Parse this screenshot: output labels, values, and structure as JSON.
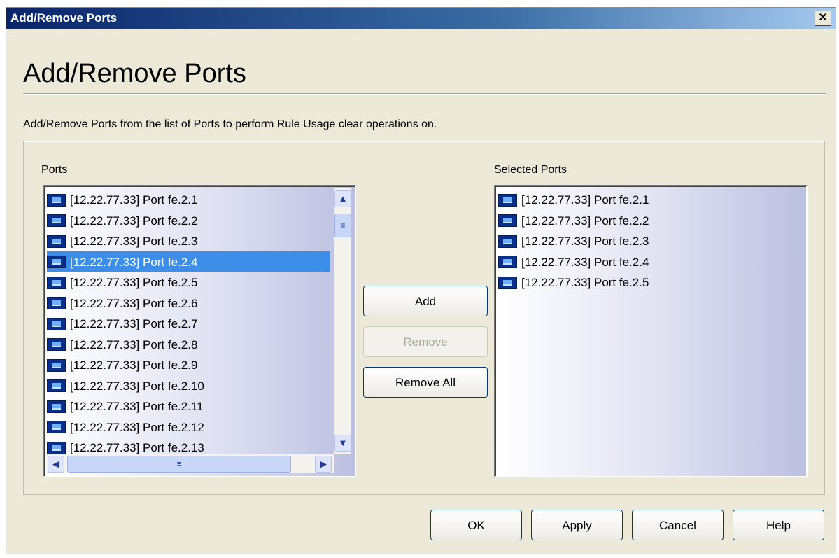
{
  "window": {
    "title": "Add/Remove Ports",
    "close_glyph": "✕"
  },
  "heading": "Add/Remove Ports",
  "description": "Add/Remove Ports from the list of Ports to perform Rule Usage clear operations on.",
  "ports_panel": {
    "label": "Ports",
    "items": [
      {
        "label": "[12.22.77.33] Port fe.2.1",
        "icon": "port-icon",
        "selected": false
      },
      {
        "label": "[12.22.77.33] Port fe.2.2",
        "icon": "port-icon",
        "selected": false
      },
      {
        "label": "[12.22.77.33] Port fe.2.3",
        "icon": "port-icon",
        "selected": false
      },
      {
        "label": "[12.22.77.33] Port fe.2.4",
        "icon": "port-icon",
        "selected": true
      },
      {
        "label": "[12.22.77.33] Port fe.2.5",
        "icon": "port-icon",
        "selected": false
      },
      {
        "label": "[12.22.77.33] Port fe.2.6",
        "icon": "port-icon",
        "selected": false
      },
      {
        "label": "[12.22.77.33] Port fe.2.7",
        "icon": "port-icon",
        "selected": false
      },
      {
        "label": "[12.22.77.33] Port fe.2.8",
        "icon": "port-icon",
        "selected": false
      },
      {
        "label": "[12.22.77.33] Port fe.2.9",
        "icon": "port-icon",
        "selected": false
      },
      {
        "label": "[12.22.77.33] Port fe.2.10",
        "icon": "port-icon",
        "selected": false
      },
      {
        "label": "[12.22.77.33] Port fe.2.11",
        "icon": "port-icon",
        "selected": false
      },
      {
        "label": "[12.22.77.33] Port fe.2.12",
        "icon": "port-icon",
        "selected": false
      },
      {
        "label": "[12.22.77.33] Port fe.2.13",
        "icon": "port-icon",
        "selected": false
      }
    ]
  },
  "selected_panel": {
    "label": "Selected Ports",
    "items": [
      {
        "label": "[12.22.77.33] Port fe.2.1",
        "icon": "port-icon"
      },
      {
        "label": "[12.22.77.33] Port fe.2.2",
        "icon": "port-icon"
      },
      {
        "label": "[12.22.77.33] Port fe.2.3",
        "icon": "port-icon"
      },
      {
        "label": "[12.22.77.33] Port fe.2.4",
        "icon": "port-icon"
      },
      {
        "label": "[12.22.77.33] Port fe.2.5",
        "icon": "port-icon"
      }
    ]
  },
  "transfer_buttons": {
    "add": "Add",
    "remove": "Remove",
    "remove_all": "Remove All",
    "remove_enabled": false
  },
  "footer_buttons": {
    "ok": "OK",
    "apply": "Apply",
    "cancel": "Cancel",
    "help": "Help"
  },
  "scrollbar_glyphs": {
    "up": "▲",
    "down": "▼",
    "left": "◀",
    "right": "▶",
    "grip": "≡"
  },
  "colors": {
    "title_bar": "#0a246a",
    "selection": "#3d8ee9",
    "dialog_bg": "#ece9d8"
  }
}
